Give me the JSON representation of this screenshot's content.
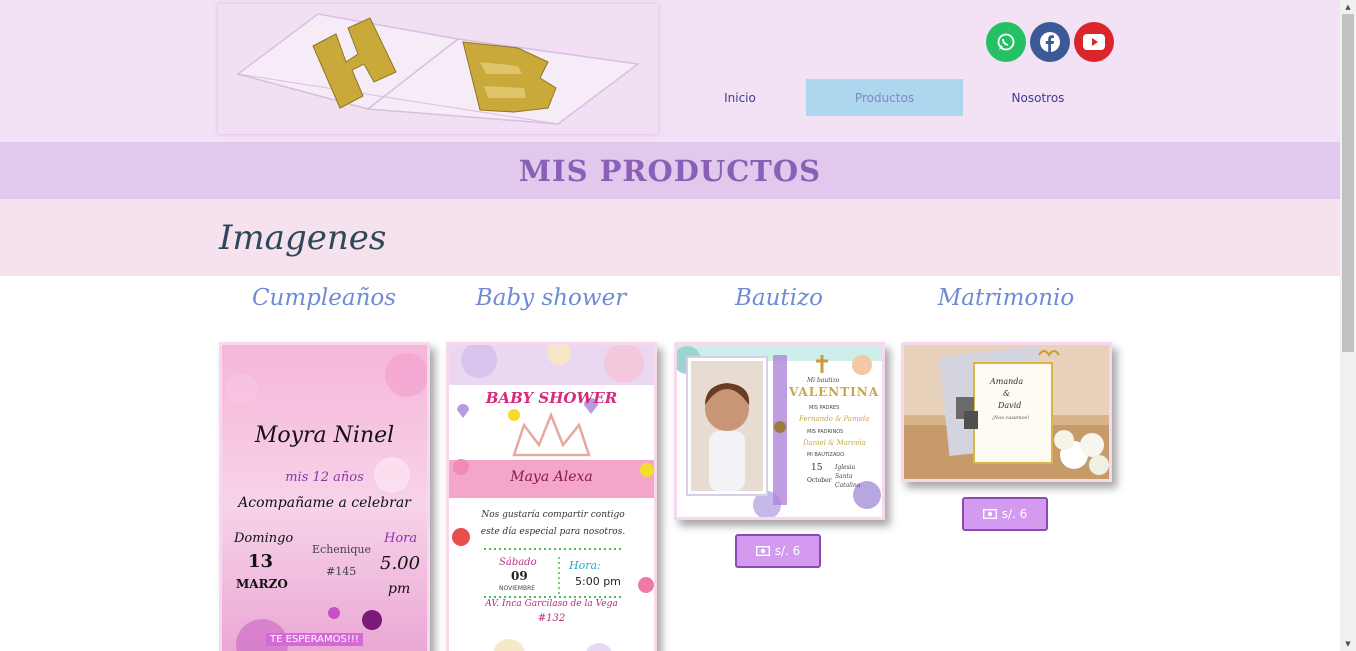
{
  "header": {
    "logo_text": "HB",
    "nav": [
      {
        "label": "Inicio"
      },
      {
        "label": "Productos"
      },
      {
        "label": "Nosotros"
      }
    ],
    "social": [
      "whatsapp-icon",
      "facebook-icon",
      "youtube-icon"
    ]
  },
  "banner": {
    "title": "MIS PRODUCTOS"
  },
  "section": {
    "title": "Imagenes"
  },
  "categories": [
    {
      "name": "Cumpleaños"
    },
    {
      "name": "Baby shower"
    },
    {
      "name": "Bautizo"
    },
    {
      "name": "Matrimonio"
    }
  ],
  "cards": [
    {
      "name": "Moyra Ninel",
      "line1": "mis 12 años",
      "line2": "Acompañame a celebrar",
      "day_label": "Domingo",
      "day": "13",
      "month": "MARZO",
      "place1": "Echenique",
      "place2": "#145",
      "hour_label": "Hora",
      "hour": "5.00",
      "hour_unit": "pm",
      "footer": "TE ESPERAMOS!!!"
    },
    {
      "heading": "BABY SHOWER",
      "name": "Maya Alexa",
      "message": "Nos gustaría compartir contigo este día especial para nosotros.",
      "day_label": "Sábado",
      "day": "09",
      "month": "NOVIEMBRE",
      "hour_label": "Hora:",
      "hour": "5:00 pm",
      "address": "AV. Inca Garcilaso de la Vega",
      "number": "#132"
    },
    {
      "title_small": "Mi bautizo",
      "name": "VALENTINA",
      "parents_label": "MIS PADRES",
      "parents": "Fernando & Pamela",
      "godparents_label": "MIS PADRINOS",
      "godparents": "Daniel & Marcela",
      "date_label": "MI BAUTIZADO",
      "day": "15",
      "month": "October",
      "church": "Iglesia Santa Catalina",
      "price": "s/. 6"
    },
    {
      "names_1": "Amanda",
      "amp": "&",
      "names_2": "David",
      "tagline": "¡Nos casamos!",
      "price": "s/. 6"
    }
  ],
  "colors": {
    "header_bg": "#f3e1f5",
    "banner_bg": "#e2c8ec",
    "strip_bg": "#f6e2ee",
    "active_nav": "#acd7ef",
    "button_bg": "#d49af0"
  }
}
